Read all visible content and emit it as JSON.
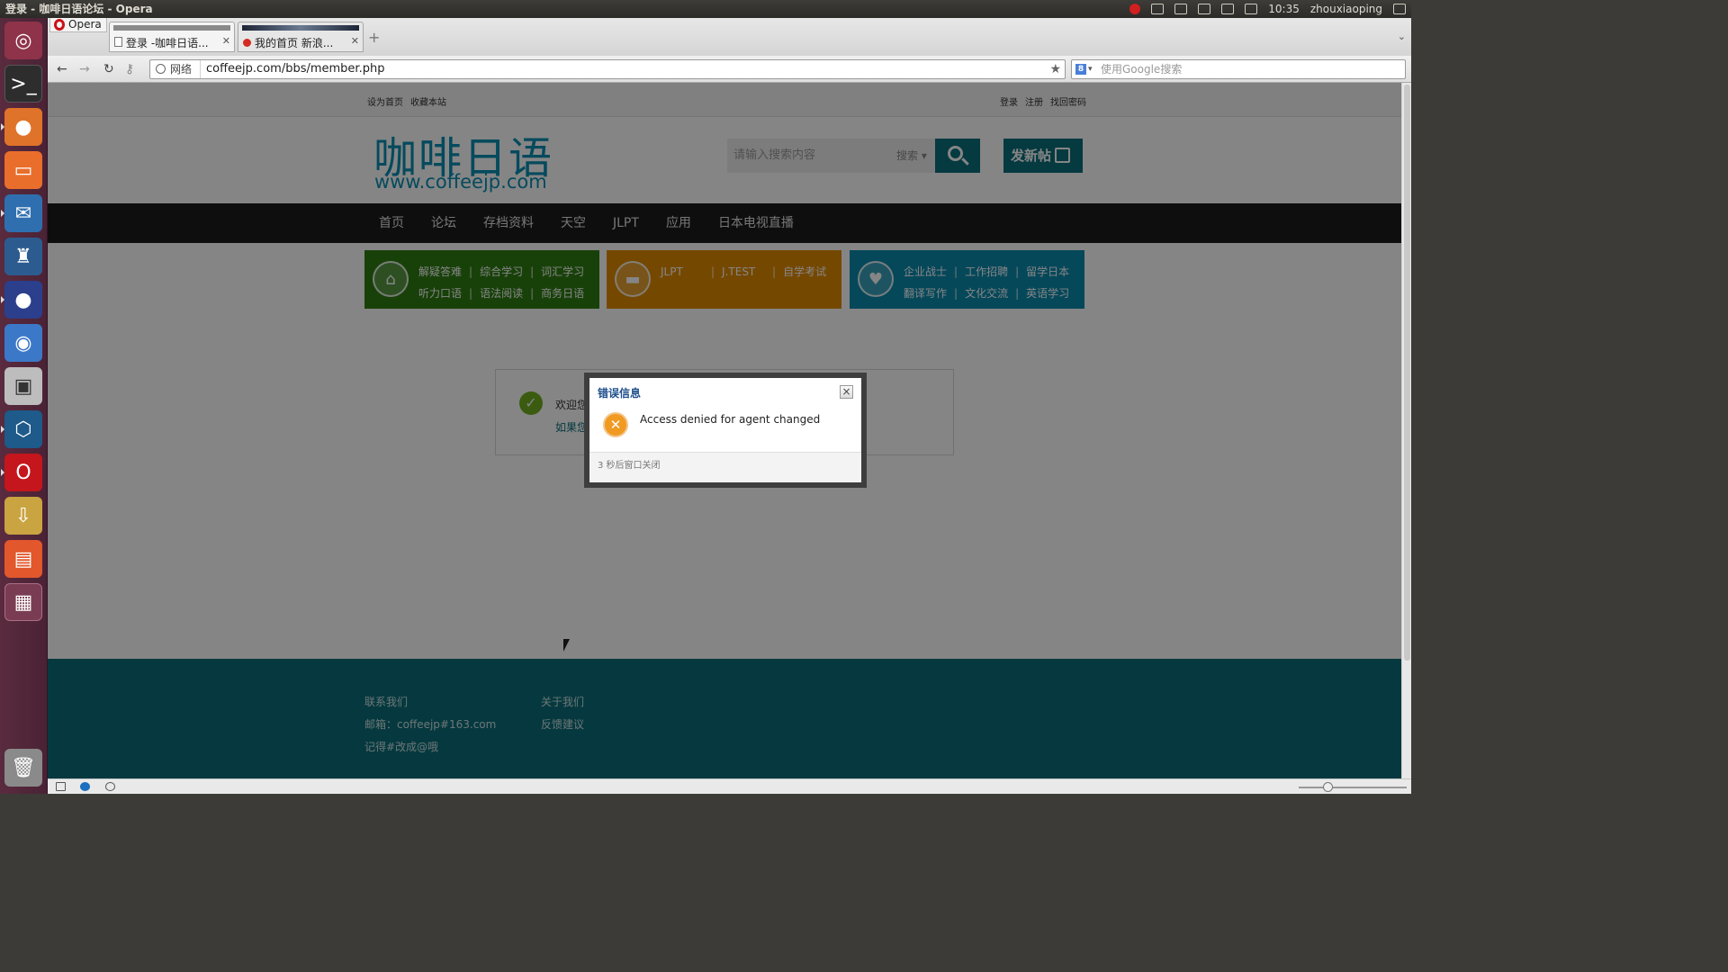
{
  "top_panel": {
    "window_title": "登录 - 咖啡日语论坛 - Opera",
    "time": "10:35",
    "user": "zhouxiaoping"
  },
  "launcher": {
    "items": [
      "ubuntu-dash",
      "terminal",
      "firefox",
      "files",
      "thunderbird",
      "postgres-elephant",
      "eclipse",
      "chromium",
      "camera",
      "virtualbox",
      "opera",
      "archive-manager",
      "software-center",
      "workspace-switcher",
      "trash"
    ]
  },
  "browser": {
    "menu_label": "Opera",
    "tabs": [
      {
        "label": "登录 -咖啡日语...",
        "active": true
      },
      {
        "label": "我的首页 新浪...",
        "active": false
      }
    ],
    "address": {
      "security_label": "网络",
      "url": "coffeejp.com/bbs/member.php"
    },
    "search_placeholder": "使用Google搜索"
  },
  "page": {
    "topbar": {
      "left_links": [
        "设为首页",
        "收藏本站"
      ],
      "right_links": [
        "登录",
        "注册",
        "找回密码"
      ]
    },
    "logo_cn": "咖啡日语",
    "logo_url": "www.coffeejp.com",
    "site_search": {
      "placeholder": "请输入搜索内容",
      "scope": "搜索 ▾"
    },
    "post_button": "发新帖",
    "nav": [
      "首页",
      "论坛",
      "存档资料",
      "天空",
      "JLPT",
      "应用",
      "日本电视直播"
    ],
    "categories": [
      {
        "color": "#2e7d12",
        "rows": [
          [
            "解疑答难",
            "综合学习",
            "词汇学习"
          ],
          [
            "听力口语",
            "语法阅读",
            "商务日语"
          ]
        ]
      },
      {
        "color": "#e08b00",
        "rows": [
          [
            "JLPT",
            "J.TEST",
            "自学考试"
          ],
          []
        ]
      },
      {
        "color": "#0a8aac",
        "rows": [
          [
            "企业战士",
            "工作招聘",
            "留学日本"
          ],
          [
            "翻译写作",
            "文化交流",
            "英语学习"
          ]
        ]
      }
    ],
    "content": {
      "welcome": "欢迎您",
      "if_you": "如果您"
    },
    "footer": {
      "col1": [
        "联系我们",
        "邮箱：coffeejp#163.com",
        "记得#改成@哦"
      ],
      "col2": [
        "关于我们",
        "反馈建议"
      ]
    }
  },
  "dialog": {
    "title": "错误信息",
    "message": "Access denied for agent changed",
    "footer": "3 秒后窗口关闭"
  }
}
